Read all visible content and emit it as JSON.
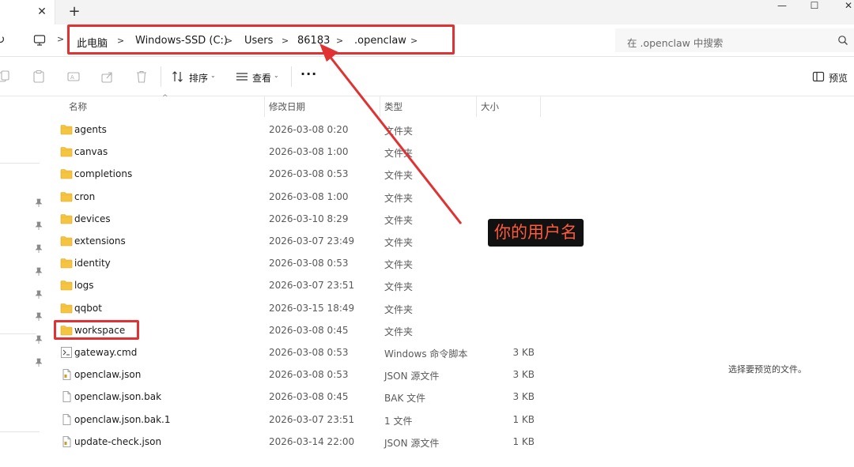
{
  "window": {
    "tab_close_glyph": "✕",
    "new_tab_glyph": "+",
    "minimize_glyph": "—",
    "maximize_glyph": "☐",
    "close_glyph": "✕"
  },
  "address": {
    "breadcrumb": [
      "此电脑",
      "Windows-SSD (C:)",
      "Users",
      "86183",
      ".openclaw"
    ],
    "search_placeholder": "在 .openclaw 中搜索"
  },
  "toolbar": {
    "sort_label": "排序",
    "view_label": "查看",
    "more_label": "···",
    "preview_label": "预览"
  },
  "columns": {
    "name": "名称",
    "date": "修改日期",
    "type": "类型",
    "size": "大小"
  },
  "files": [
    {
      "name": "agents",
      "date": "2026-03-08 0:20",
      "type": "文件夹",
      "size": "",
      "icon": "folder-icon"
    },
    {
      "name": "canvas",
      "date": "2026-03-08 1:00",
      "type": "文件夹",
      "size": "",
      "icon": "folder-icon"
    },
    {
      "name": "completions",
      "date": "2026-03-08 0:53",
      "type": "文件夹",
      "size": "",
      "icon": "folder-icon"
    },
    {
      "name": "cron",
      "date": "2026-03-08 1:00",
      "type": "文件夹",
      "size": "",
      "icon": "folder-icon"
    },
    {
      "name": "devices",
      "date": "2026-03-10 8:29",
      "type": "文件夹",
      "size": "",
      "icon": "folder-icon"
    },
    {
      "name": "extensions",
      "date": "2026-03-07 23:49",
      "type": "文件夹",
      "size": "",
      "icon": "folder-icon"
    },
    {
      "name": "identity",
      "date": "2026-03-08 0:53",
      "type": "文件夹",
      "size": "",
      "icon": "folder-icon"
    },
    {
      "name": "logs",
      "date": "2026-03-07 23:51",
      "type": "文件夹",
      "size": "",
      "icon": "folder-icon"
    },
    {
      "name": "qqbot",
      "date": "2026-03-15 18:49",
      "type": "文件夹",
      "size": "",
      "icon": "folder-icon"
    },
    {
      "name": "workspace",
      "date": "2026-03-08 0:45",
      "type": "文件夹",
      "size": "",
      "icon": "folder-icon"
    },
    {
      "name": "gateway.cmd",
      "date": "2026-03-08 0:53",
      "type": "Windows 命令脚本",
      "size": "3 KB",
      "icon": "script-file-icon"
    },
    {
      "name": "openclaw.json",
      "date": "2026-03-08 0:53",
      "type": "JSON 源文件",
      "size": "3 KB",
      "icon": "json-file-icon"
    },
    {
      "name": "openclaw.json.bak",
      "date": "2026-03-08 0:45",
      "type": "BAK 文件",
      "size": "3 KB",
      "icon": "file-icon"
    },
    {
      "name": "openclaw.json.bak.1",
      "date": "2026-03-07 23:51",
      "type": "1 文件",
      "size": "1 KB",
      "icon": "file-icon"
    },
    {
      "name": "update-check.json",
      "date": "2026-03-14 22:00",
      "type": "JSON 源文件",
      "size": "1 KB",
      "icon": "json-file-icon"
    }
  ],
  "preview_pane": {
    "empty_text": "选择要预览的文件。"
  },
  "annotation": {
    "label": "你的用户名",
    "color": "#e03232"
  }
}
